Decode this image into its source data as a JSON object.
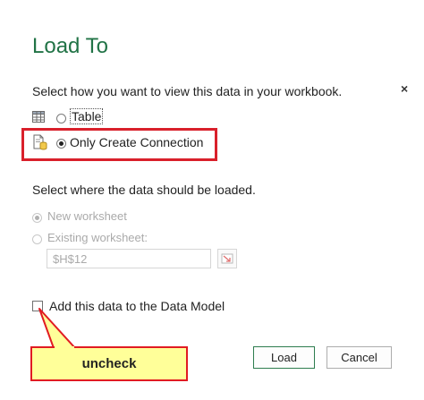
{
  "dialog": {
    "title": "Load To",
    "close_glyph": "×"
  },
  "view_section": {
    "prompt": "Select how you want to view this data in your workbook.",
    "options": [
      {
        "label": "Table",
        "selected": false,
        "icon": "table-icon"
      },
      {
        "label": "Only Create Connection",
        "selected": true,
        "icon": "connection-icon"
      }
    ]
  },
  "load_section": {
    "prompt": "Select where the data should be loaded.",
    "options": [
      {
        "label": "New worksheet",
        "selected": true,
        "enabled": false
      },
      {
        "label": "Existing worksheet:",
        "selected": false,
        "enabled": false
      }
    ],
    "cell_reference": "$H$12",
    "collapse_icon": "range-select-icon"
  },
  "data_model": {
    "label": "Add this data to the Data Model",
    "checked": false
  },
  "buttons": {
    "load": "Load",
    "cancel": "Cancel"
  },
  "annotation": {
    "callout_text": "uncheck",
    "highlight_color": "#d9202b",
    "callout_fill": "#ffff99"
  },
  "colors": {
    "title": "#217346",
    "disabled_text": "#aaaaaa"
  }
}
